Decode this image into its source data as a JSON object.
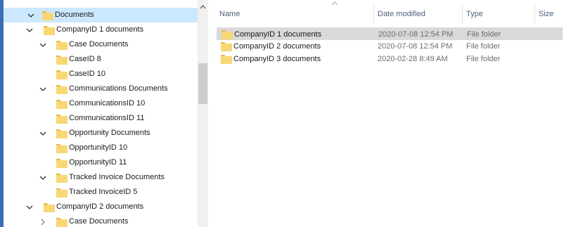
{
  "colors": {
    "selection": "#cce8ff",
    "folder_fill": "#f8d775",
    "folder_back": "#e9b84a",
    "row_selected": "#d9d9d9",
    "frame": "#3a6fb3"
  },
  "nav": {
    "items": [
      {
        "label": "Documents",
        "expanded": true,
        "selected": true
      },
      {
        "label": "CompanyID 1 documents",
        "expanded": true
      },
      {
        "label": "Case Documents",
        "expanded": true
      },
      {
        "label": "CaseID 8"
      },
      {
        "label": "CaseID 10"
      },
      {
        "label": "Communications Documents",
        "expanded": true
      },
      {
        "label": "CommunicationsID 10"
      },
      {
        "label": "CommunicationsID 11"
      },
      {
        "label": "Opportunity Documents",
        "expanded": true
      },
      {
        "label": "OpportunityID 10"
      },
      {
        "label": "OpportunityID 11"
      },
      {
        "label": "Tracked Invoice Documents",
        "expanded": true
      },
      {
        "label": "Tracked InvoiceID 5"
      },
      {
        "label": "CompanyID 2 documents",
        "expanded": true
      },
      {
        "label": "Case Documents",
        "expanded": false
      }
    ]
  },
  "columns": {
    "name": "Name",
    "date": "Date modified",
    "type": "Type",
    "size": "Size"
  },
  "files": [
    {
      "name": "CompanyID 1 documents",
      "date": "2020-07-08 12:54 PM",
      "type": "File folder",
      "selected": true
    },
    {
      "name": "CompanyID 2 documents",
      "date": "2020-07-08 12:54 PM",
      "type": "File folder"
    },
    {
      "name": "CompanyID 3 documents",
      "date": "2020-02-28 8:49 AM",
      "type": "File folder"
    }
  ]
}
